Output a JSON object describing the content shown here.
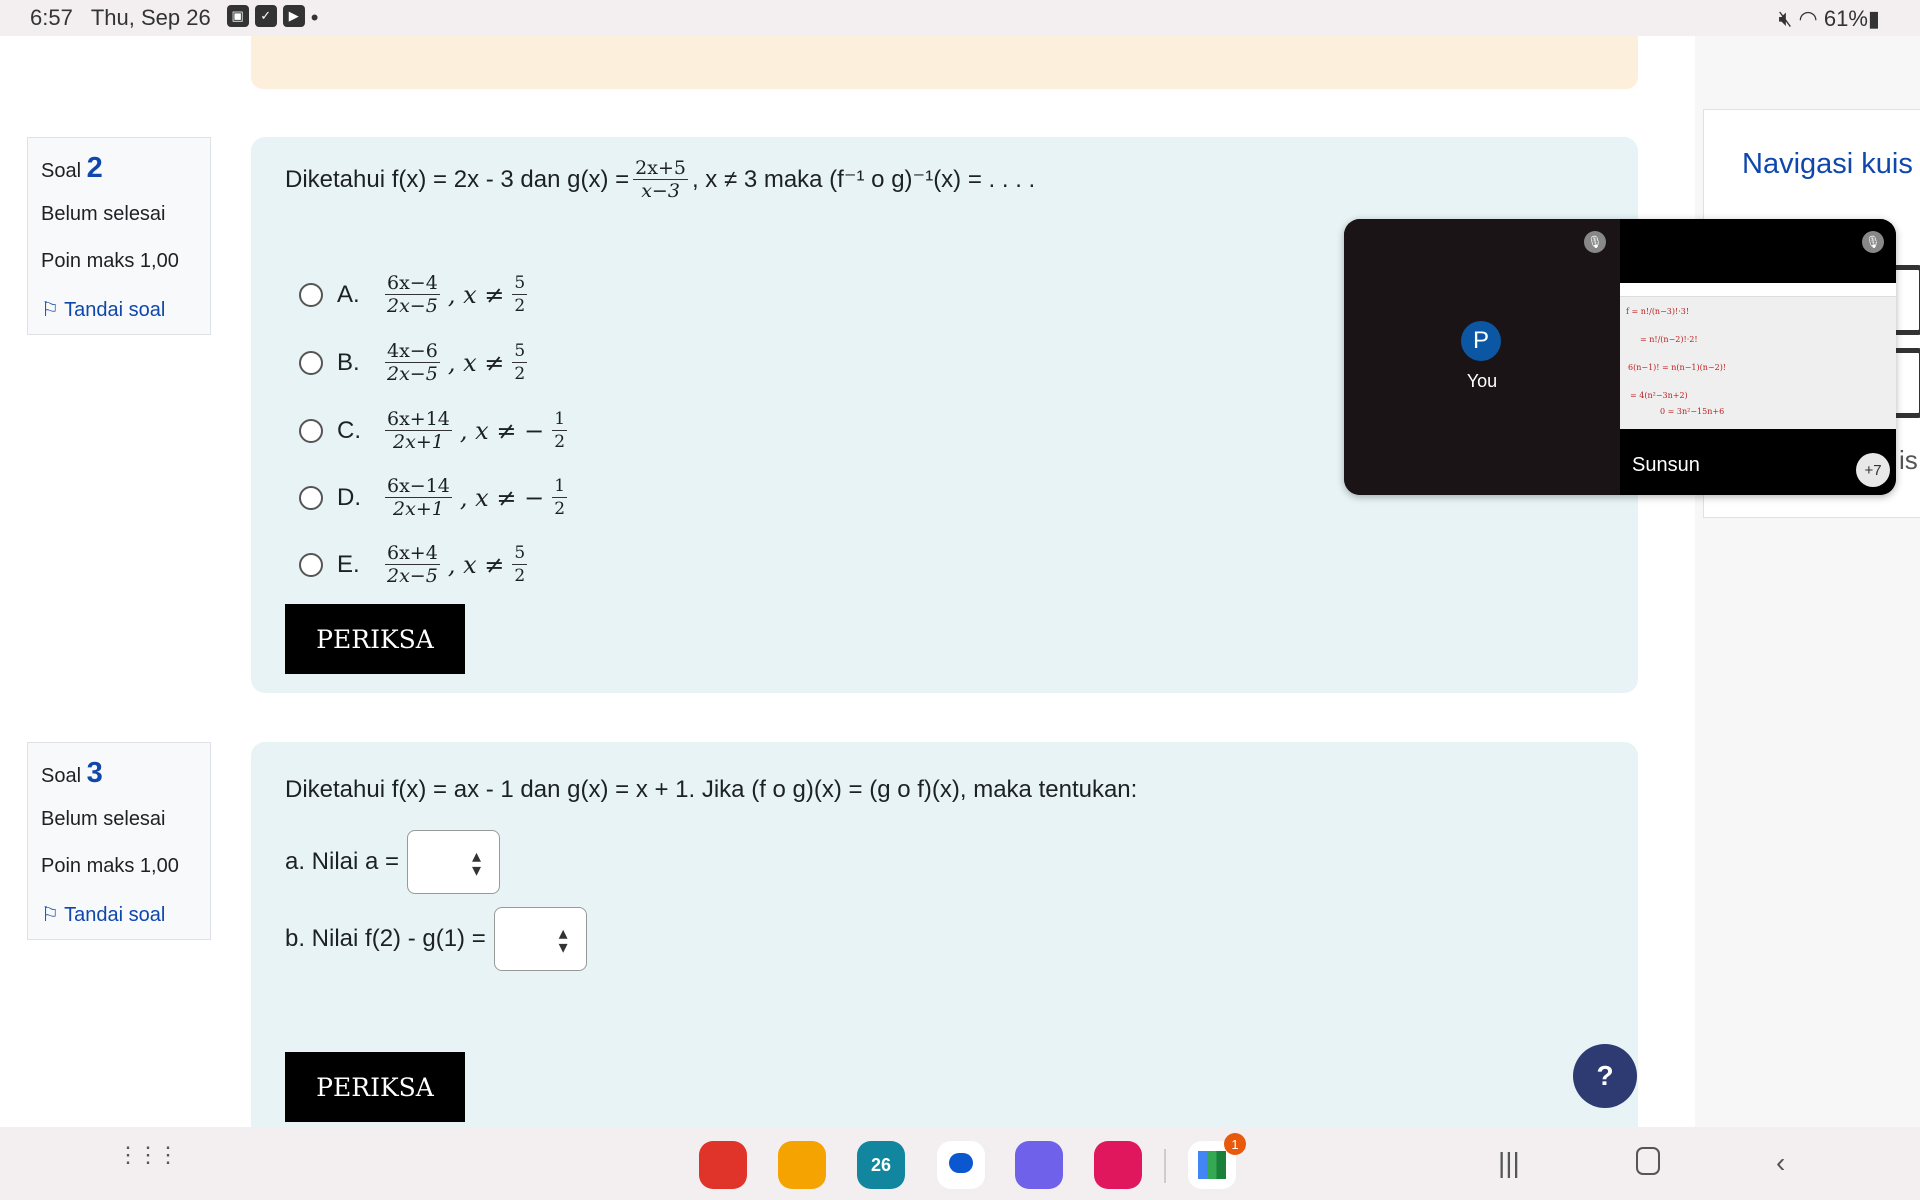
{
  "status_bar": {
    "time": "6:57",
    "date": "Thu, Sep 26",
    "battery": "61%"
  },
  "sidebar": {
    "title": "Navigasi kuis",
    "partial": "is"
  },
  "questions": [
    {
      "label": "Soal",
      "number": "2",
      "status": "Belum selesai",
      "points": "Poin maks 1,00",
      "flag": "Tandai soal",
      "text_pre": "Diketahui f(x) = 2x - 3 dan g(x) =",
      "g_num": "2x+5",
      "g_den": "x−3",
      "text_post": ", x ≠ 3 maka (f⁻¹ o g)⁻¹(x) = . . . .",
      "options": [
        {
          "letter": "A.",
          "num": "6x−4",
          "den": "2x−5",
          "cond": ", x ≠",
          "cnum": "5",
          "cden": "2"
        },
        {
          "letter": "B.",
          "num": "4x−6",
          "den": "2x−5",
          "cond": ", x ≠",
          "cnum": "5",
          "cden": "2"
        },
        {
          "letter": "C.",
          "num": "6x+14",
          "den": "2x+1",
          "cond": ", x ≠ −",
          "cnum": "1",
          "cden": "2"
        },
        {
          "letter": "D.",
          "num": "6x−14",
          "den": "2x+1",
          "cond": ", x ≠ −",
          "cnum": "1",
          "cden": "2"
        },
        {
          "letter": "E.",
          "num": "6x+4",
          "den": "2x−5",
          "cond": ", x ≠",
          "cnum": "5",
          "cden": "2"
        }
      ],
      "check": "PERIKSA"
    },
    {
      "label": "Soal",
      "number": "3",
      "status": "Belum selesai",
      "points": "Poin maks 1,00",
      "flag": "Tandai soal",
      "text": "Diketahui f(x) = ax - 1 dan g(x) = x + 1. Jika (f o g)(x) = (g o f)(x), maka tentukan:",
      "part_a": "a. Nilai a =",
      "part_b": "b. Nilai f(2) - g(1) =",
      "check": "PERIKSA"
    }
  ],
  "help": "?",
  "video": {
    "self_initial": "P",
    "self_label": "You",
    "presenter": "Sunsun",
    "more": "+7"
  },
  "dock": {
    "calendar_day": "26",
    "meet_badge": "1"
  }
}
